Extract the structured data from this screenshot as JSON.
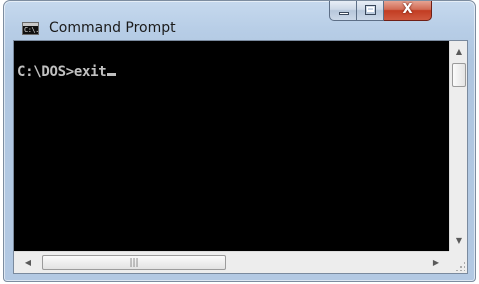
{
  "window": {
    "title": "Command Prompt",
    "icon": "console-icon",
    "icon_glyph": "C:\\."
  },
  "caption_buttons": {
    "minimize": "minimize-icon",
    "maximize": "maximize-icon",
    "close_glyph": "X"
  },
  "console": {
    "line": "C:\\DOS>exit",
    "background": "#000000",
    "foreground": "#c0c0c0"
  },
  "scrollbars": {
    "up_glyph": "▲",
    "down_glyph": "▼",
    "left_glyph": "◀",
    "right_glyph": "▶",
    "grip": "|||"
  }
}
